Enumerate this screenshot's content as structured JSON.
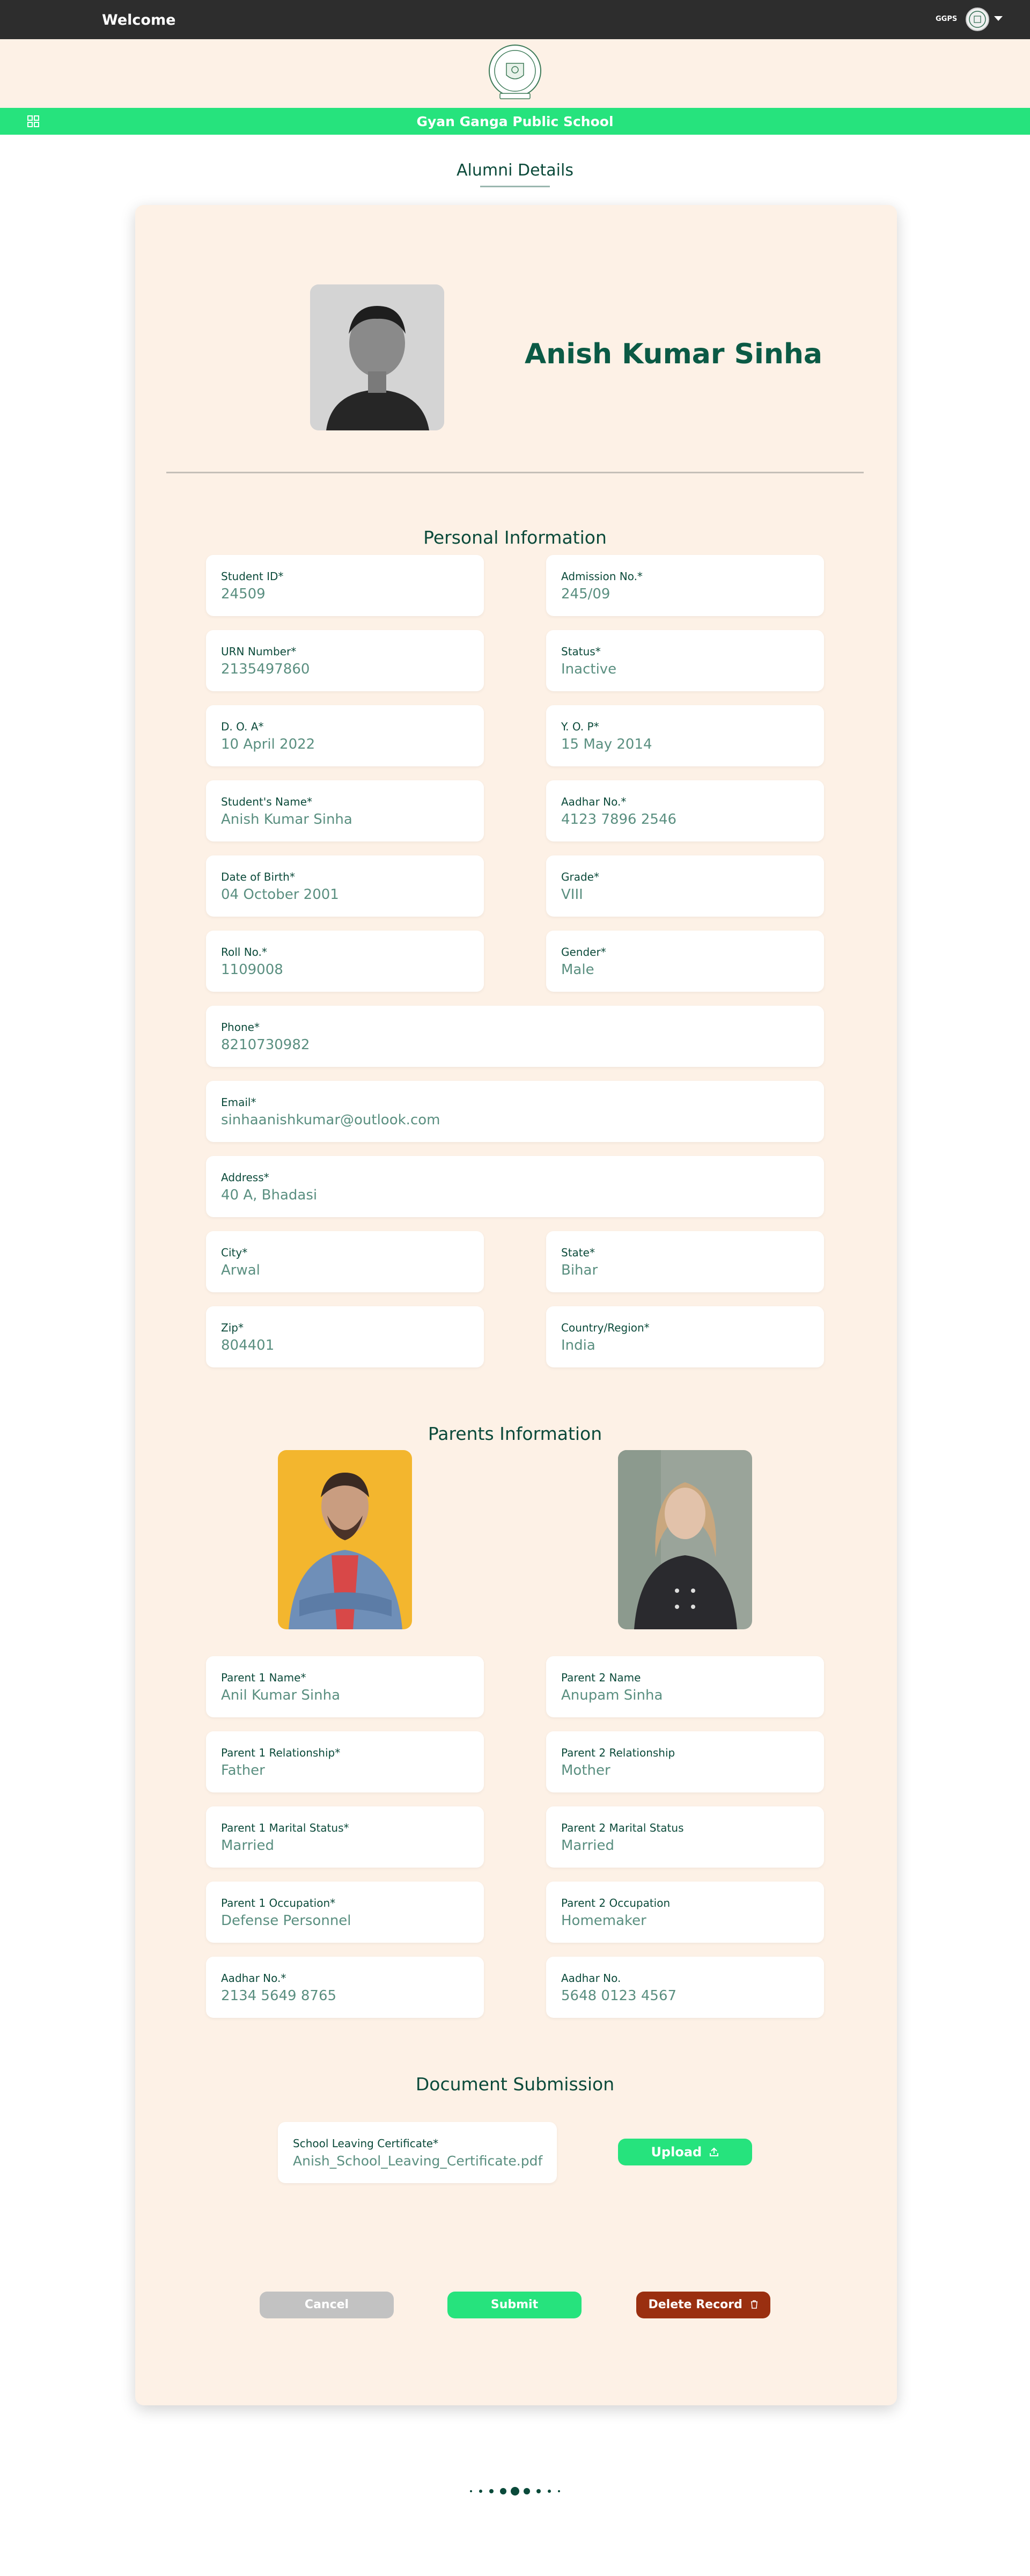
{
  "topbar": {
    "welcome": "Welcome",
    "user_abbr": "GGPS"
  },
  "school": {
    "name": "Gyan Ganga Public School"
  },
  "page": {
    "title": "Alumni Details"
  },
  "student": {
    "name": "Anish Kumar Sinha"
  },
  "personal": {
    "title": "Personal Information",
    "student_id": {
      "label": "Student ID*",
      "value": "24509"
    },
    "admission_no": {
      "label": "Admission No.*",
      "value": "245/09"
    },
    "urn": {
      "label": "URN Number*",
      "value": "2135497860"
    },
    "status": {
      "label": "Status*",
      "value": "Inactive"
    },
    "doa": {
      "label": "D. O. A*",
      "value": "10 April 2022"
    },
    "yop": {
      "label": "Y. O. P*",
      "value": "15 May 2014"
    },
    "students_name": {
      "label": "Student's Name*",
      "value": "Anish Kumar Sinha"
    },
    "aadhar": {
      "label": "Aadhar No.*",
      "value": "4123 7896 2546"
    },
    "dob": {
      "label": "Date of Birth*",
      "value": "04 October 2001"
    },
    "grade": {
      "label": "Grade*",
      "value": "VIII"
    },
    "roll": {
      "label": "Roll No.*",
      "value": "1109008"
    },
    "gender": {
      "label": "Gender*",
      "value": "Male"
    },
    "phone": {
      "label": "Phone*",
      "value": "8210730982"
    },
    "email": {
      "label": "Email*",
      "value": "sinhaanishkumar@outlook.com"
    },
    "address": {
      "label": "Address*",
      "value": "40 A, Bhadasi"
    },
    "city": {
      "label": "City*",
      "value": "Arwal"
    },
    "state": {
      "label": "State*",
      "value": "Bihar"
    },
    "zip": {
      "label": "Zip*",
      "value": "804401"
    },
    "country": {
      "label": "Country/Region*",
      "value": "India"
    }
  },
  "parents": {
    "title": "Parents Information",
    "p1_name": {
      "label": "Parent 1 Name*",
      "value": "Anil Kumar Sinha"
    },
    "p2_name": {
      "label": "Parent 2 Name",
      "value": "Anupam Sinha"
    },
    "p1_rel": {
      "label": "Parent 1 Relationship*",
      "value": "Father"
    },
    "p2_rel": {
      "label": "Parent 2 Relationship",
      "value": "Mother"
    },
    "p1_marital": {
      "label": "Parent 1 Marital Status*",
      "value": "Married"
    },
    "p2_marital": {
      "label": "Parent 2 Marital Status",
      "value": "Married"
    },
    "p1_occ": {
      "label": "Parent 1 Occupation*",
      "value": "Defense Personnel"
    },
    "p2_occ": {
      "label": "Parent 2 Occupation",
      "value": "Homemaker"
    },
    "p1_aadhar": {
      "label": "Aadhar No.*",
      "value": "2134 5649 8765"
    },
    "p2_aadhar": {
      "label": "Aadhar No.",
      "value": "5648 0123 4567"
    }
  },
  "documents": {
    "title": "Document Submission",
    "slc": {
      "label": "School Leaving Certificate*",
      "value": "Anish_School_Leaving_Certificate.pdf"
    },
    "upload_label": "Upload"
  },
  "actions": {
    "cancel": "Cancel",
    "submit": "Submit",
    "delete": "Delete Record"
  },
  "colors": {
    "brand_green": "#26e37d",
    "dark_green": "#0b4a3a",
    "cream": "#fdf1e6",
    "delete_red": "#9a2f10",
    "cancel_grey": "#c2c2c2"
  },
  "icons": {
    "menu": "grid-icon",
    "dropdown": "caret-down-icon",
    "upload": "upload-icon",
    "delete": "trash-icon"
  }
}
